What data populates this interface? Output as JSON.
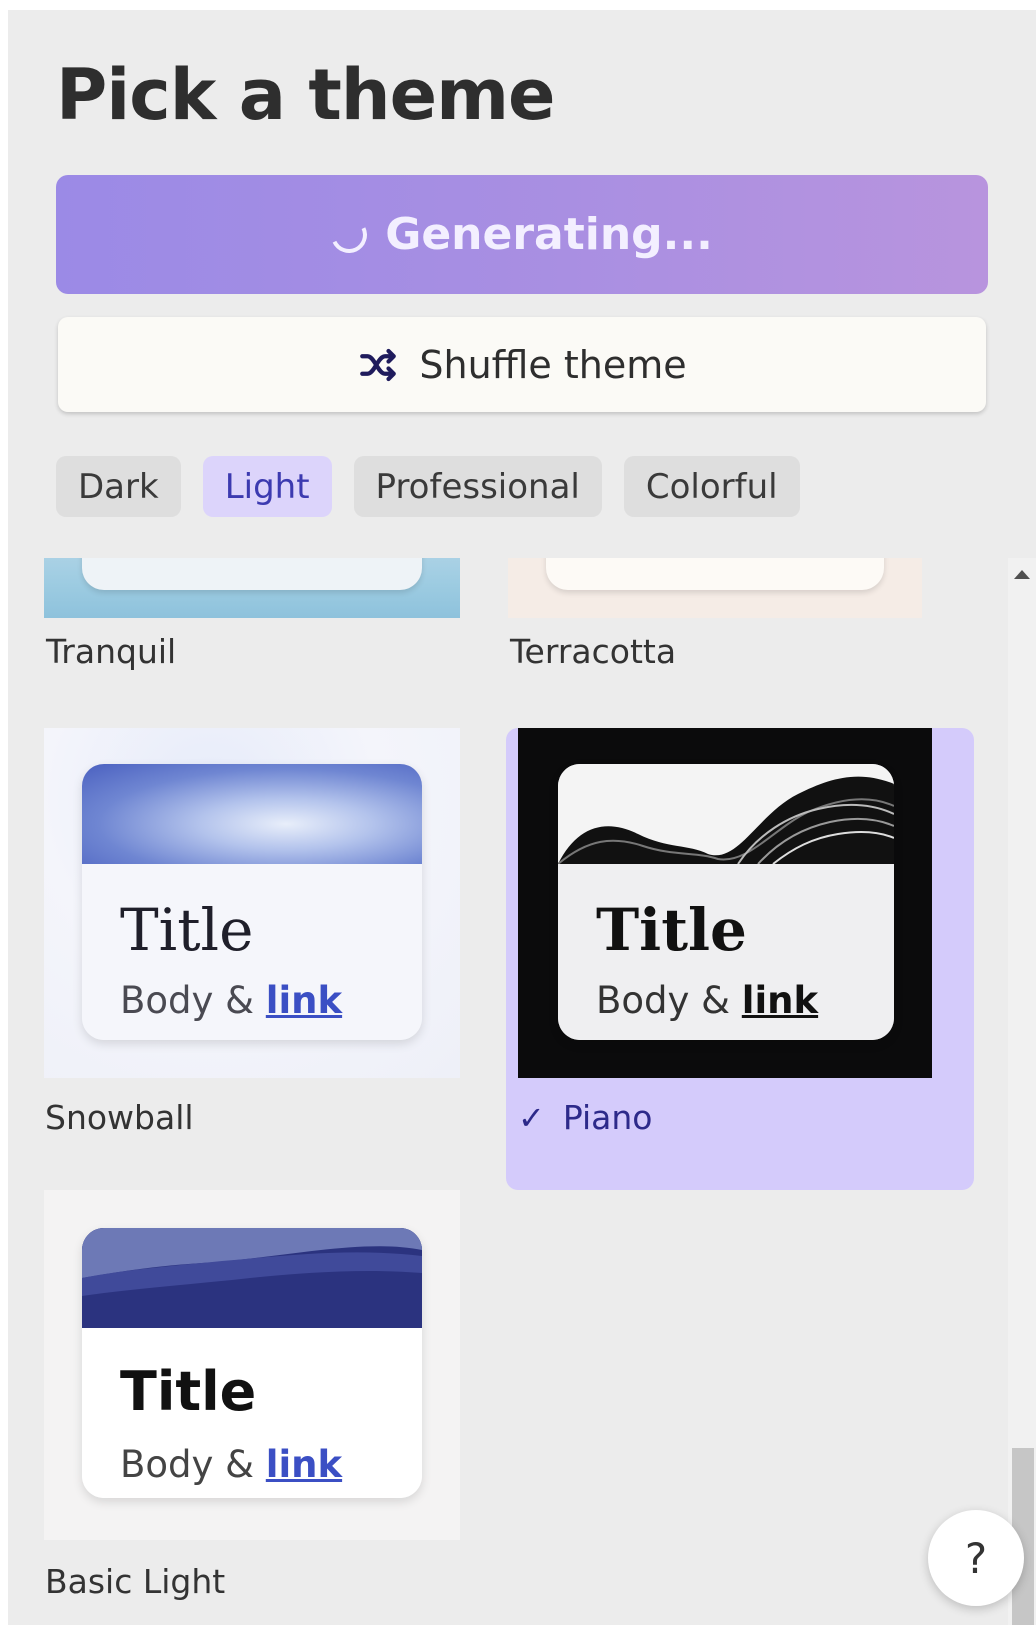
{
  "header": {
    "title": "Pick a theme",
    "generate_label": "Generating...",
    "shuffle_label": "Shuffle theme"
  },
  "filters": [
    {
      "label": "Dark",
      "active": false
    },
    {
      "label": "Light",
      "active": true
    },
    {
      "label": "Professional",
      "active": false
    },
    {
      "label": "Colorful",
      "active": false
    }
  ],
  "themes": {
    "tranquil": {
      "name": "Tranquil"
    },
    "terracotta": {
      "name": "Terracotta"
    },
    "snowball": {
      "name": "Snowball",
      "card_title": "Title",
      "card_body": "Body &",
      "card_link": "link"
    },
    "piano": {
      "name": "Piano",
      "card_title": "Title",
      "card_body": "Body &",
      "card_link": "link",
      "selected": true
    },
    "basic_light": {
      "name": "Basic Light",
      "card_title": "Title",
      "card_body": "Body &",
      "card_link": "link"
    }
  },
  "help": {
    "label": "?"
  },
  "colors": {
    "accent_gradient_start": "#9b8ae6",
    "accent_gradient_end": "#b894de",
    "selected_bg": "#d4cbfb",
    "link_blue": "#3b4fc4"
  },
  "icons": {
    "shuffle": "shuffle-icon",
    "spinner": "spinner-icon",
    "check": "check-icon"
  }
}
